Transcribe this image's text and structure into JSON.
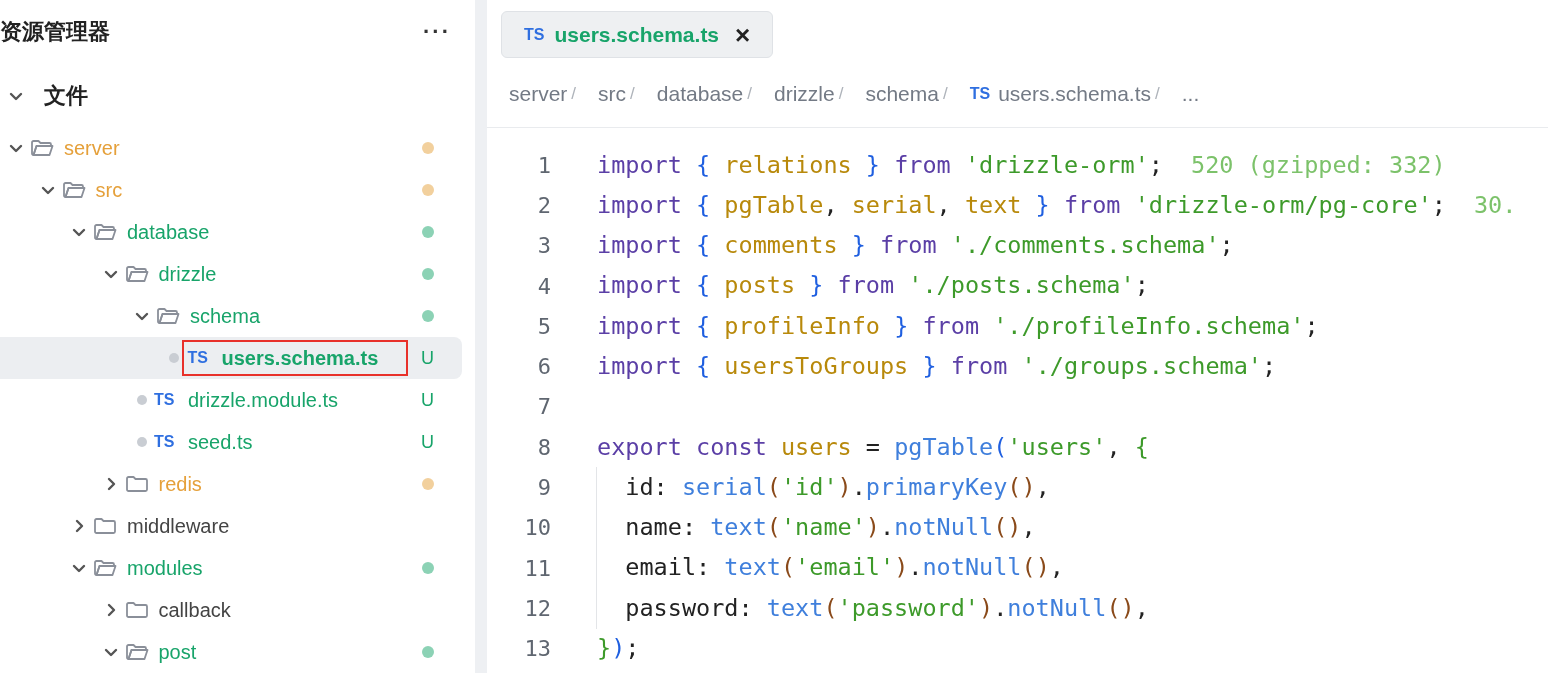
{
  "sidebar": {
    "title": "资源管理器",
    "more": "···",
    "section": {
      "label": "文件",
      "expanded": true
    },
    "tree": [
      {
        "name": "server",
        "kind": "folder",
        "expanded": true,
        "color": "#e5a03a",
        "children": [
          {
            "name": "src",
            "kind": "folder",
            "expanded": true,
            "color": "#e5a03a",
            "children": [
              {
                "name": "database",
                "kind": "folder",
                "expanded": true,
                "color": "#18a46a",
                "children": [
                  {
                    "name": "drizzle",
                    "kind": "folder",
                    "expanded": true,
                    "color": "#18a46a",
                    "children": [
                      {
                        "name": "schema",
                        "kind": "folder",
                        "expanded": true,
                        "color": "#18a46a",
                        "children": [
                          {
                            "name": "users.schema.ts",
                            "kind": "file",
                            "icon_text": "TS",
                            "color": "#18a46a",
                            "badge": "U",
                            "selected": true,
                            "highlighted": true
                          }
                        ]
                      },
                      {
                        "name": "drizzle.module.ts",
                        "kind": "file",
                        "icon_text": "TS",
                        "color": "#18a46a",
                        "badge": "U",
                        "selected": false,
                        "highlighted": false
                      },
                      {
                        "name": "seed.ts",
                        "kind": "file",
                        "icon_text": "TS",
                        "color": "#18a46a",
                        "badge": "U",
                        "selected": false,
                        "highlighted": false
                      }
                    ]
                  },
                  {
                    "name": "redis",
                    "kind": "folder",
                    "expanded": false,
                    "color": "#e5a03a"
                  }
                ]
              },
              {
                "name": "middleware",
                "kind": "folder",
                "expanded": false
              },
              {
                "name": "modules",
                "kind": "folder",
                "expanded": true,
                "color": "#18a46a",
                "children": [
                  {
                    "name": "callback",
                    "kind": "folder",
                    "expanded": false
                  },
                  {
                    "name": "post",
                    "kind": "folder",
                    "expanded": true,
                    "color": "#18a46a"
                  }
                ]
              }
            ]
          }
        ]
      }
    ]
  },
  "editor": {
    "tabs": [
      {
        "icon_text": "TS",
        "label": "users.schema.ts",
        "close": "×",
        "selected": true
      }
    ],
    "breadcrumb": [
      {
        "label": "server",
        "sep": "/"
      },
      {
        "label": "src",
        "sep": "/"
      },
      {
        "label": "database",
        "sep": "/"
      },
      {
        "label": "drizzle",
        "sep": "/"
      },
      {
        "label": "schema",
        "sep": "/"
      },
      {
        "icon_text": "TS",
        "label": "users.schema.ts",
        "sep": "/"
      },
      {
        "label": "..."
      }
    ],
    "lines": [
      {
        "number": "1",
        "tokens": [
          {
            "kind": "kw",
            "text": "import "
          },
          {
            "kind": "brace",
            "text": "{ "
          },
          {
            "kind": "ident",
            "text": "relations"
          },
          {
            "kind": "brace",
            "text": " } "
          },
          {
            "kind": "kw",
            "text": "from "
          },
          {
            "kind": "str",
            "text": "'drizzle-orm'"
          },
          {
            "kind": "plain",
            "text": ";"
          }
        ],
        "hint": "520 (gzipped: 332)"
      },
      {
        "number": "2",
        "tokens": [
          {
            "kind": "kw",
            "text": "import "
          },
          {
            "kind": "brace",
            "text": "{ "
          },
          {
            "kind": "ident",
            "text": "pgTable"
          },
          {
            "kind": "plain",
            "text": ", "
          },
          {
            "kind": "ident",
            "text": "serial"
          },
          {
            "kind": "plain",
            "text": ", "
          },
          {
            "kind": "ident",
            "text": "text"
          },
          {
            "kind": "brace",
            "text": " } "
          },
          {
            "kind": "kw",
            "text": "from "
          },
          {
            "kind": "str",
            "text": "'drizzle-orm/pg-core'"
          },
          {
            "kind": "plain",
            "text": ";"
          }
        ],
        "hint": "30."
      },
      {
        "number": "3",
        "tokens": [
          {
            "kind": "kw",
            "text": "import "
          },
          {
            "kind": "brace",
            "text": "{ "
          },
          {
            "kind": "ident",
            "text": "comments"
          },
          {
            "kind": "brace",
            "text": " } "
          },
          {
            "kind": "kw",
            "text": "from "
          },
          {
            "kind": "str",
            "text": "'./comments.schema'"
          },
          {
            "kind": "plain",
            "text": ";"
          }
        ]
      },
      {
        "number": "4",
        "tokens": [
          {
            "kind": "kw",
            "text": "import "
          },
          {
            "kind": "brace",
            "text": "{ "
          },
          {
            "kind": "ident",
            "text": "posts"
          },
          {
            "kind": "brace",
            "text": " } "
          },
          {
            "kind": "kw",
            "text": "from "
          },
          {
            "kind": "str",
            "text": "'./posts.schema'"
          },
          {
            "kind": "plain",
            "text": ";"
          }
        ]
      },
      {
        "number": "5",
        "tokens": [
          {
            "kind": "kw",
            "text": "import "
          },
          {
            "kind": "brace",
            "text": "{ "
          },
          {
            "kind": "ident",
            "text": "profileInfo"
          },
          {
            "kind": "brace",
            "text": " } "
          },
          {
            "kind": "kw",
            "text": "from "
          },
          {
            "kind": "str",
            "text": "'./profileInfo.schema'"
          },
          {
            "kind": "plain",
            "text": ";"
          }
        ]
      },
      {
        "number": "6",
        "tokens": [
          {
            "kind": "kw",
            "text": "import "
          },
          {
            "kind": "brace",
            "text": "{ "
          },
          {
            "kind": "ident",
            "text": "usersToGroups"
          },
          {
            "kind": "brace",
            "text": " } "
          },
          {
            "kind": "kw",
            "text": "from "
          },
          {
            "kind": "str",
            "text": "'./groups.schema'"
          },
          {
            "kind": "plain",
            "text": ";"
          }
        ]
      },
      {
        "number": "7"
      },
      {
        "number": "8",
        "tokens": [
          {
            "kind": "kw",
            "text": "export const "
          },
          {
            "kind": "ident",
            "text": "users"
          },
          {
            "kind": "plain",
            "text": " = "
          },
          {
            "kind": "fn",
            "text": "pgTable"
          },
          {
            "kind": "brace",
            "text": "("
          },
          {
            "kind": "str",
            "text": "'users'"
          },
          {
            "kind": "plain",
            "text": ", "
          },
          {
            "kind": "str",
            "text": "{"
          }
        ]
      },
      {
        "number": "9",
        "indent_guide": true,
        "tokens": [
          {
            "kind": "plain",
            "text": "  id: "
          },
          {
            "kind": "fn",
            "text": "serial"
          },
          {
            "kind": "paren",
            "text": "("
          },
          {
            "kind": "str",
            "text": "'id'"
          },
          {
            "kind": "paren",
            "text": ")"
          },
          {
            "kind": "plain",
            "text": "."
          },
          {
            "kind": "fn",
            "text": "primaryKey"
          },
          {
            "kind": "paren",
            "text": "()"
          },
          {
            "kind": "plain",
            "text": ","
          }
        ]
      },
      {
        "number": "10",
        "indent_guide": true,
        "tokens": [
          {
            "kind": "plain",
            "text": "  name: "
          },
          {
            "kind": "fn",
            "text": "text"
          },
          {
            "kind": "paren",
            "text": "("
          },
          {
            "kind": "str",
            "text": "'name'"
          },
          {
            "kind": "paren",
            "text": ")"
          },
          {
            "kind": "plain",
            "text": "."
          },
          {
            "kind": "fn",
            "text": "notNull"
          },
          {
            "kind": "paren",
            "text": "()"
          },
          {
            "kind": "plain",
            "text": ","
          }
        ]
      },
      {
        "number": "11",
        "indent_guide": true,
        "tokens": [
          {
            "kind": "plain",
            "text": "  email: "
          },
          {
            "kind": "fn",
            "text": "text"
          },
          {
            "kind": "paren",
            "text": "("
          },
          {
            "kind": "str",
            "text": "'email'"
          },
          {
            "kind": "paren",
            "text": ")"
          },
          {
            "kind": "plain",
            "text": "."
          },
          {
            "kind": "fn",
            "text": "notNull"
          },
          {
            "kind": "paren",
            "text": "()"
          },
          {
            "kind": "plain",
            "text": ","
          }
        ]
      },
      {
        "number": "12",
        "indent_guide": true,
        "tokens": [
          {
            "kind": "plain",
            "text": "  password: "
          },
          {
            "kind": "fn",
            "text": "text"
          },
          {
            "kind": "paren",
            "text": "("
          },
          {
            "kind": "str",
            "text": "'password'"
          },
          {
            "kind": "paren",
            "text": ")"
          },
          {
            "kind": "plain",
            "text": "."
          },
          {
            "kind": "fn",
            "text": "notNull"
          },
          {
            "kind": "paren",
            "text": "()"
          },
          {
            "kind": "plain",
            "text": ","
          }
        ]
      },
      {
        "number": "13",
        "tokens": [
          {
            "kind": "str",
            "text": "}"
          },
          {
            "kind": "brace",
            "text": ")"
          },
          {
            "kind": "plain",
            "text": ";"
          }
        ]
      }
    ]
  }
}
